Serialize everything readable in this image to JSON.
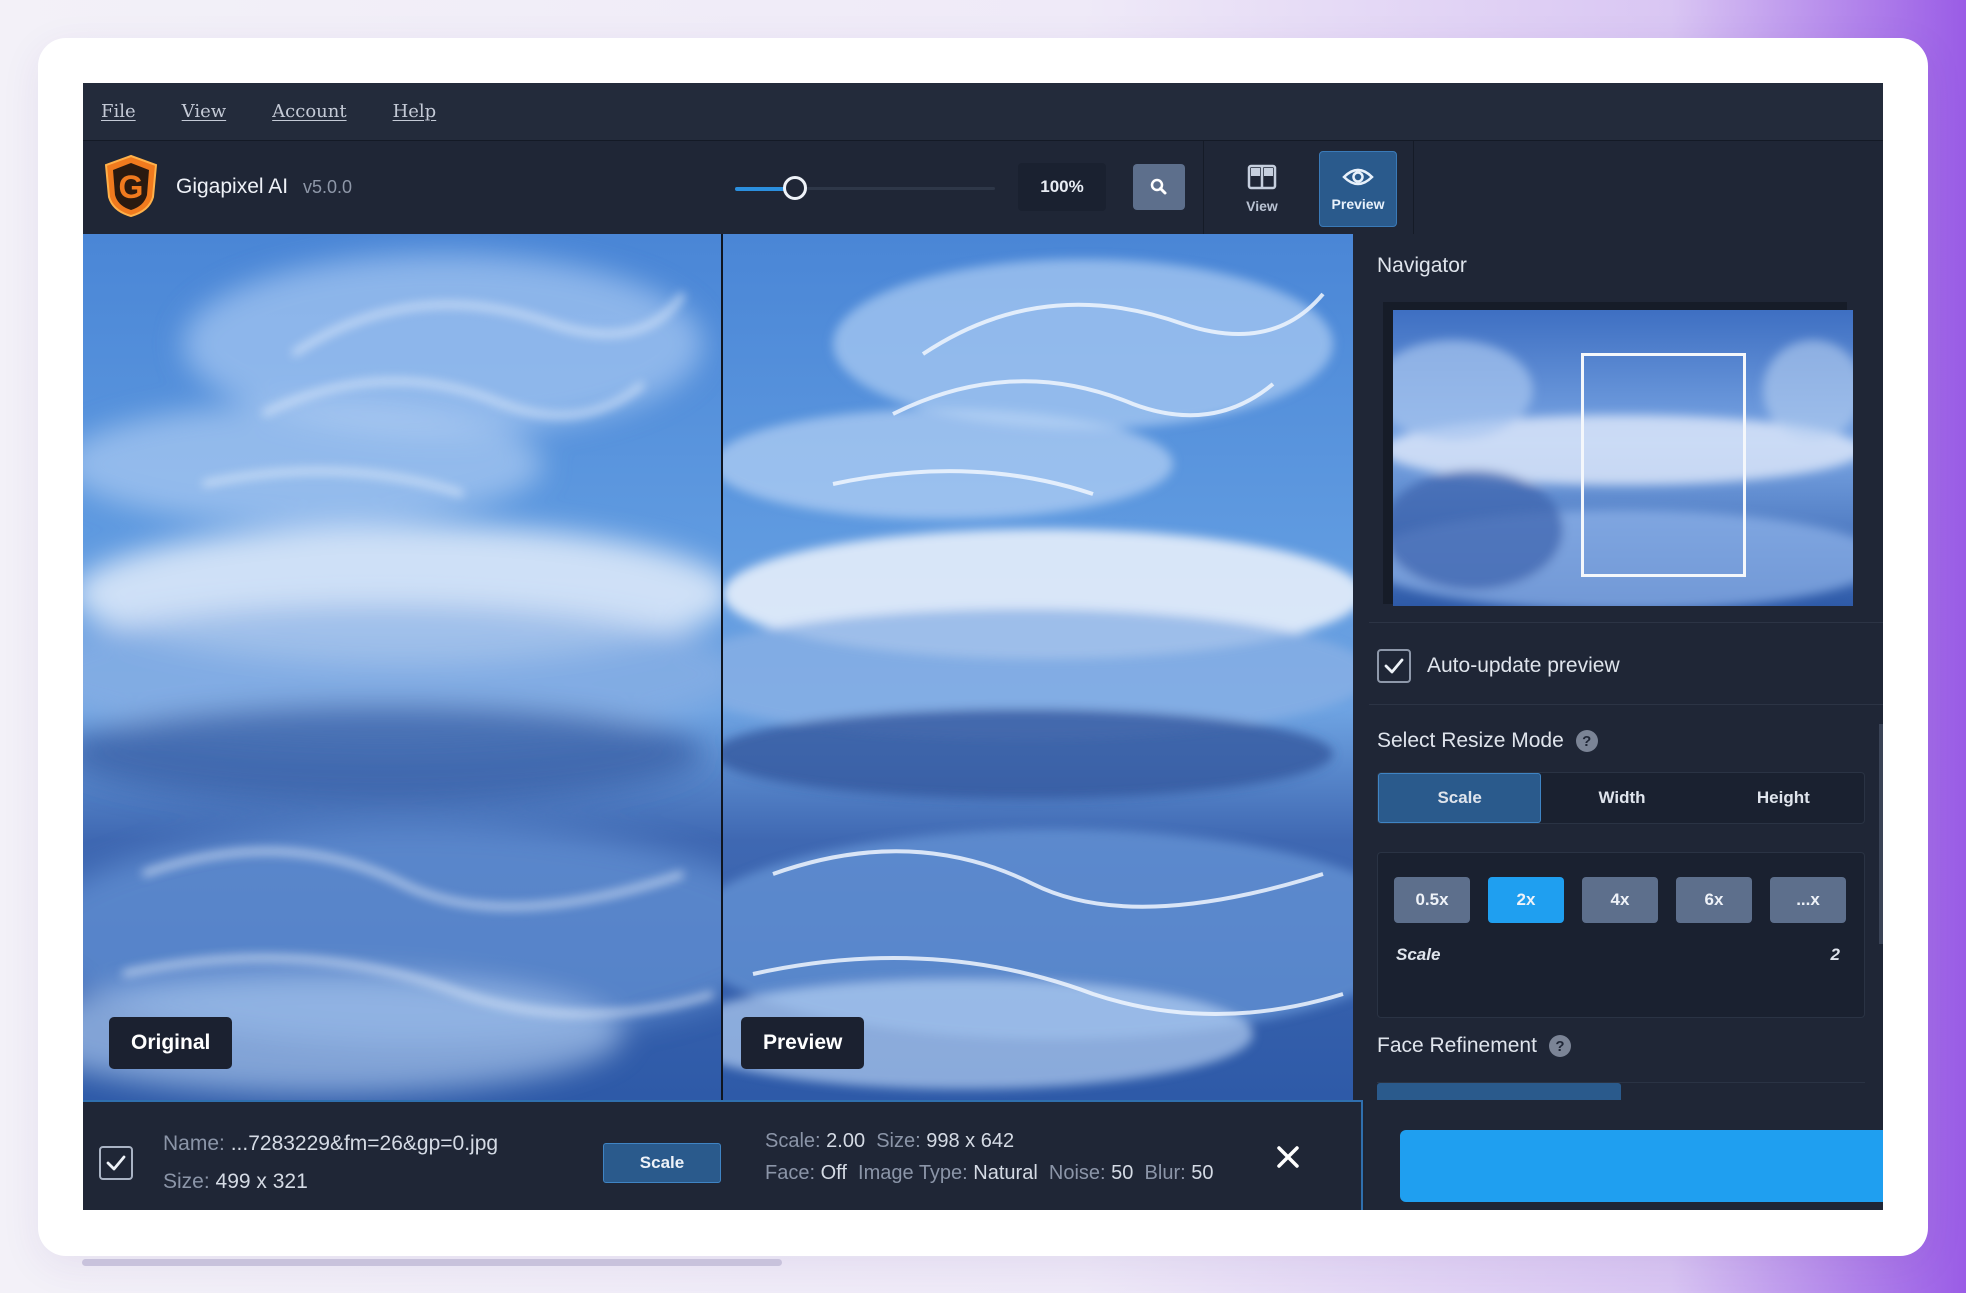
{
  "menu": {
    "file": "File",
    "view": "View",
    "account": "Account",
    "help": "Help"
  },
  "app": {
    "name": "Gigapixel AI",
    "version": "v5.0.0",
    "logo_letter": "G"
  },
  "toolbar": {
    "zoom_level": "100%",
    "zoom_slider_fraction": 0.2,
    "view_label": "View",
    "preview_label": "Preview"
  },
  "panels": {
    "original_label": "Original",
    "preview_label": "Preview"
  },
  "sidebar": {
    "navigator_title": "Navigator",
    "auto_update_label": "Auto-update preview",
    "auto_update_checked": true,
    "resize_mode_title": "Select Resize Mode",
    "resize_modes": [
      "Scale",
      "Width",
      "Height"
    ],
    "resize_mode_selected": "Scale",
    "scale_chips": [
      "0.5x",
      "2x",
      "4x",
      "6x",
      "...x"
    ],
    "scale_chip_selected": "2x",
    "scale_label": "Scale",
    "scale_value": "2",
    "face_refinement_title": "Face Refinement"
  },
  "status": {
    "name_label": "Name:",
    "name_value": "...7283229&fm=26&gp=0.jpg",
    "size_label": "Size:",
    "size_value": "499 x 321",
    "mode_button": "Scale",
    "scale_label": "Scale:",
    "scale_value": "2.00",
    "out_size_label": "Size:",
    "out_size_value": "998 x 642",
    "face_label": "Face:",
    "face_value": "Off",
    "image_type_label": "Image Type:",
    "image_type_value": "Natural",
    "noise_label": "Noise:",
    "noise_value": "50",
    "blur_label": "Blur:",
    "blur_value": "50"
  },
  "colors": {
    "accent": "#1f9ff0",
    "active": "#2a5a8c",
    "background": "#1d2434",
    "logo": "#f07a1e"
  },
  "icons": [
    "search-icon",
    "view-split-icon",
    "eye-icon",
    "help-icon",
    "check-icon",
    "close-icon"
  ]
}
